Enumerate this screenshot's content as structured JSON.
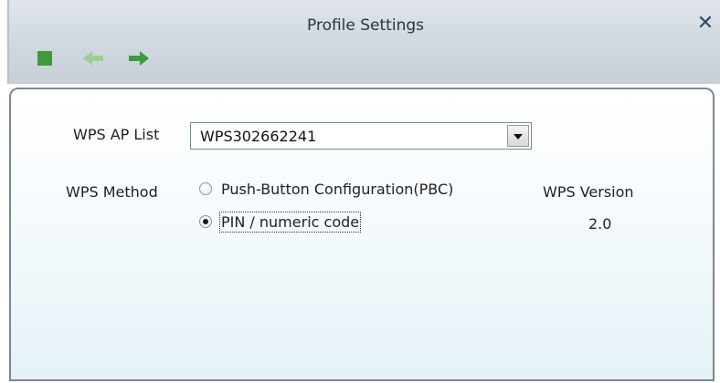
{
  "window": {
    "title": "Profile Settings",
    "close_symbol": "✕"
  },
  "toolbar": {
    "stop_icon": "stop-icon",
    "back_icon": "back-arrow-icon",
    "forward_icon": "forward-arrow-icon",
    "colors": {
      "stop": "#3f9a3a",
      "back": "#9bcf93",
      "forward": "#3f9a3a"
    }
  },
  "form": {
    "ap_list_label": "WPS AP List",
    "ap_list_value": "WPS302662241",
    "method_label": "WPS Method",
    "methods": [
      {
        "label": "Push-Button Configuration(PBC)",
        "selected": false
      },
      {
        "label": "PIN / numeric code",
        "selected": true
      }
    ],
    "version_label": "WPS Version",
    "version_value": "2.0"
  }
}
